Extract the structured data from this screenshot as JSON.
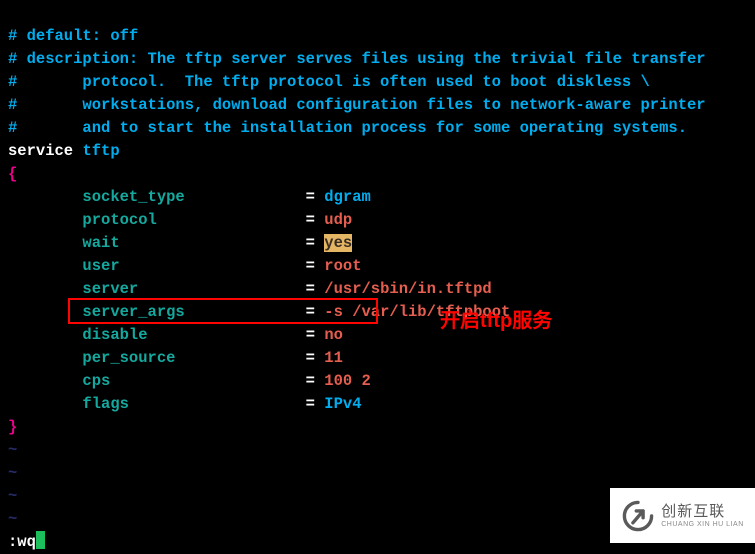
{
  "comments": [
    "# default: off",
    "# description: The tftp server serves files using the trivial file transfer",
    "#       protocol.  The tftp protocol is often used to boot diskless \\",
    "#       workstations, download configuration files to network-aware printer",
    "#       and to start the installation process for some operating systems."
  ],
  "service_keyword": "service",
  "service_name": "tftp",
  "brace_open": "{",
  "brace_close": "}",
  "params": {
    "socket_type": {
      "key": "socket_type",
      "value": "dgram",
      "cls": "val-dgram"
    },
    "protocol": {
      "key": "protocol",
      "value": "udp",
      "cls": "val-udp"
    },
    "wait": {
      "key": "wait",
      "value": "yes",
      "cls": "val-yes"
    },
    "user": {
      "key": "user",
      "value": "root",
      "cls": "val-root"
    },
    "server": {
      "key": "server",
      "value": "/usr/sbin/in.tftpd",
      "cls": "val-path"
    },
    "server_args": {
      "key": "server_args",
      "value": "-s /var/lib/tftpboot",
      "cls": "val-args"
    },
    "disable": {
      "key": "disable",
      "value": "no",
      "cls": "val-no"
    },
    "per_source": {
      "key": "per_source",
      "value": "11",
      "cls": "val-11"
    },
    "cps": {
      "key": "cps",
      "value": "100 2",
      "cls": "val-cps"
    },
    "flags": {
      "key": "flags",
      "value": "IPv4",
      "cls": "val-ipv4"
    }
  },
  "tilde": "~",
  "command": ":wq",
  "annotation_text": "开启tftp服务",
  "watermark": {
    "brand_cn": "创新互联",
    "brand_en": "CHUANG XIN HU LIAN"
  }
}
